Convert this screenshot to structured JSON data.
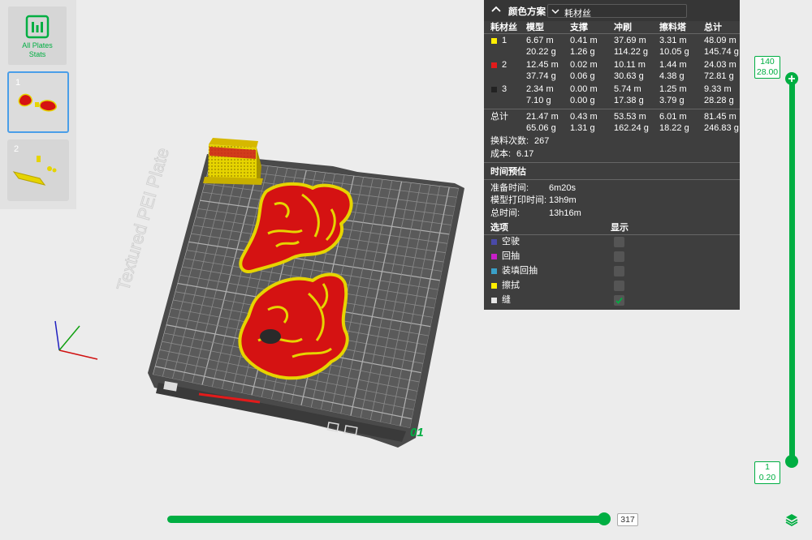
{
  "sidebar": {
    "stats_label": "All Plates Stats",
    "plates": [
      {
        "number": "1"
      },
      {
        "number": "2"
      }
    ]
  },
  "panel": {
    "header_label": "颜色方案",
    "scheme_value": "耗材丝",
    "columns": [
      "耗材丝",
      "模型",
      "支撑",
      "冲刷",
      "擦料塔",
      "总计"
    ],
    "rows": [
      {
        "id": "1",
        "color": "#ffee00",
        "model": [
          "6.67 m",
          "20.22 g"
        ],
        "support": [
          "0.41 m",
          "1.26 g"
        ],
        "flush": [
          "37.69 m",
          "114.22 g"
        ],
        "tower": [
          "3.31 m",
          "10.05 g"
        ],
        "total": [
          "48.09 m",
          "145.74 g"
        ]
      },
      {
        "id": "2",
        "color": "#e21b1b",
        "model": [
          "12.45 m",
          "37.74 g"
        ],
        "support": [
          "0.02 m",
          "0.06 g"
        ],
        "flush": [
          "10.11 m",
          "30.63 g"
        ],
        "tower": [
          "1.44 m",
          "4.38 g"
        ],
        "total": [
          "24.03 m",
          "72.81 g"
        ]
      },
      {
        "id": "3",
        "color": "#222222",
        "model": [
          "2.34 m",
          "7.10 g"
        ],
        "support": [
          "0.00 m",
          "0.00 g"
        ],
        "flush": [
          "5.74 m",
          "17.38 g"
        ],
        "tower": [
          "1.25 m",
          "3.79 g"
        ],
        "total": [
          "9.33 m",
          "28.28 g"
        ]
      }
    ],
    "sum": {
      "label": "总计",
      "model": [
        "21.47 m",
        "65.06 g"
      ],
      "support": [
        "0.43 m",
        "1.31 g"
      ],
      "flush": [
        "53.53 m",
        "162.24 g"
      ],
      "tower": [
        "6.01 m",
        "18.22 g"
      ],
      "total": [
        "81.45 m",
        "246.83 g"
      ]
    },
    "changes_label": "换料次数:",
    "changes_value": "267",
    "cost_label": "成本:",
    "cost_value": "6.17",
    "time_title": "时间预估",
    "prep_label": "准备时间:",
    "prep_value": "6m20s",
    "model_time_label": "模型打印时间:",
    "model_time_value": "13h9m",
    "total_time_label": "总时间:",
    "total_time_value": "13h16m",
    "options_label": "选项",
    "display_label": "显示",
    "options": [
      {
        "name": "空驶",
        "color": "#4a4aa8",
        "checked": false
      },
      {
        "name": "回抽",
        "color": "#c81ec8",
        "checked": false
      },
      {
        "name": "装填回抽",
        "color": "#3aa0c8",
        "checked": false
      },
      {
        "name": "擦拭",
        "color": "#ffee00",
        "checked": false
      },
      {
        "name": "缝",
        "color": "#e6e6e6",
        "checked": true
      }
    ]
  },
  "viewport": {
    "bed_text": "Textured PEI Plate",
    "plate_label": "01"
  },
  "vertical_slider": {
    "top_layer": "140",
    "top_height": "28.00",
    "bottom_layer": "1",
    "bottom_height": "0.20"
  },
  "horizontal_slider": {
    "value": "317"
  },
  "colors": {
    "accent": "#00ae42",
    "panel": "#3e3e3e"
  }
}
